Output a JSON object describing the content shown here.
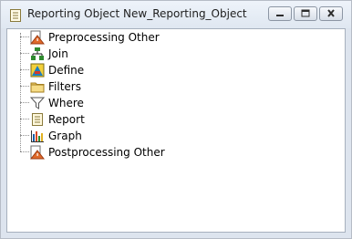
{
  "window": {
    "title": "Reporting Object New_Reporting_Object",
    "app_icon": "report-object-icon",
    "buttons": [
      {
        "name": "minimize-button",
        "icon": "minimize-icon"
      },
      {
        "name": "restore-button",
        "icon": "restore-icon"
      },
      {
        "name": "close-button",
        "icon": "close-icon"
      }
    ]
  },
  "tree": {
    "items": [
      {
        "label": "Preprocessing Other",
        "icon": "preprocessing-icon"
      },
      {
        "label": "Join",
        "icon": "join-icon"
      },
      {
        "label": "Define",
        "icon": "define-icon"
      },
      {
        "label": "Filters",
        "icon": "folder-icon"
      },
      {
        "label": "Where",
        "icon": "filter-funnel-icon"
      },
      {
        "label": "Report",
        "icon": "report-icon"
      },
      {
        "label": "Graph",
        "icon": "graph-icon"
      },
      {
        "label": "Postprocessing Other",
        "icon": "postprocessing-icon"
      }
    ]
  }
}
